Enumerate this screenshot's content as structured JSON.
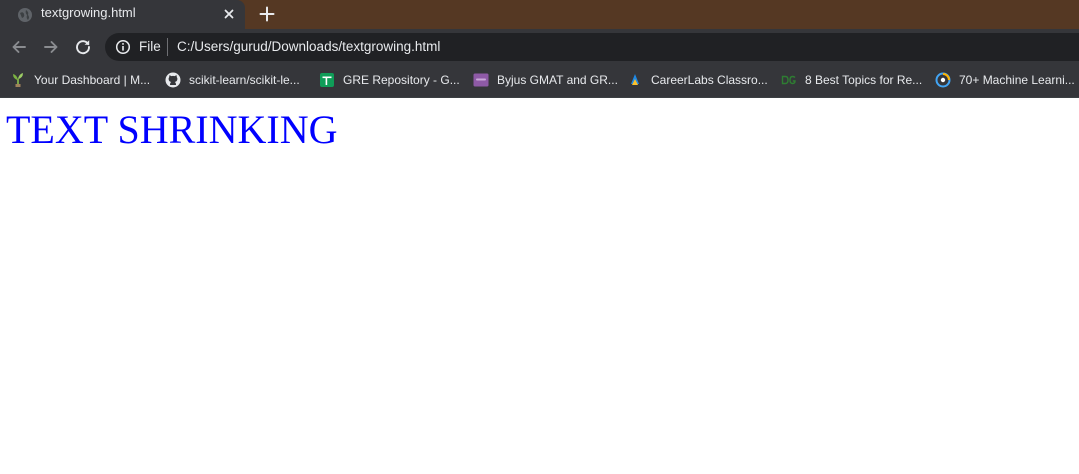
{
  "browser": {
    "tab": {
      "title": "textgrowing.html",
      "favicon": "globe-icon",
      "close_icon": "close-icon"
    },
    "new_tab_icon": "plus-icon",
    "toolbar": {
      "back_icon": "arrow-left-icon",
      "forward_icon": "arrow-right-icon",
      "reload_icon": "reload-icon",
      "site_info_icon": "info-icon",
      "scheme_label": "File",
      "url": "C:/Users/gurud/Downloads/textgrowing.html"
    },
    "bookmarks": [
      {
        "label": "Your Dashboard | M...",
        "icon": "plant-icon"
      },
      {
        "label": "scikit-learn/scikit-le...",
        "icon": "github-icon"
      },
      {
        "label": "GRE Repository - G...",
        "icon": "sheets-icon"
      },
      {
        "label": "Byjus GMAT and GR...",
        "icon": "byjus-icon"
      },
      {
        "label": "CareerLabs Classro...",
        "icon": "careerlabs-icon"
      },
      {
        "label": "8 Best Topics for Re...",
        "icon": "dg-icon"
      },
      {
        "label": "70+ Machine Learni...",
        "icon": "ml-icon"
      }
    ],
    "colors": {
      "tabstrip": "#553823",
      "toolbar": "#35363a",
      "omnibox": "#202124",
      "heading": "#0000ff"
    }
  },
  "page": {
    "heading": "TEXT SHRINKING"
  }
}
